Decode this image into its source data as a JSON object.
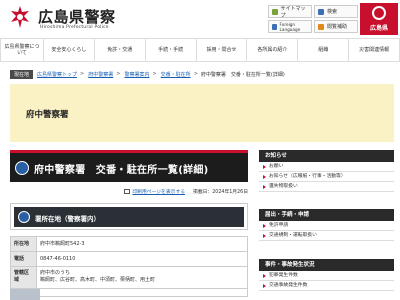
{
  "header": {
    "site_title": "広島県警察",
    "site_subtitle": "Hiroshima Prefectural Police",
    "utility": {
      "sitemap": "サイトマップ",
      "search": "検索",
      "language": "Foreign Language",
      "read_aloud": "閲覧補助"
    },
    "prefecture_badge": "広島県"
  },
  "gnav": [
    "広島県警察について",
    "安全安心くらし",
    "免許・交通",
    "手続・手続",
    "採用・問合せ",
    "各所属の紹介",
    "組織",
    "災害関連情報"
  ],
  "breadcrumb": {
    "here_label": "現在地",
    "items": [
      "広島県警察トップ",
      "府中警察署",
      "警察署案内",
      "交番・駐在所"
    ],
    "current": "府中警察署　交番・駐在所一覧(詳細)"
  },
  "banner": {
    "title": "府中警察署"
  },
  "main": {
    "heading": "府中警察署　交番・駐在所一覧(詳細)",
    "print_link": "印刷用ページを表示する",
    "posted": "掲載日：2024年1月26日",
    "sub_heading": "署所在地（警察署内）",
    "table": [
      {
        "label": "所在地",
        "value": "府中市鵜飼町542-3"
      },
      {
        "label": "電話",
        "value": "0847-46-0110"
      },
      {
        "label": "管轄区域",
        "value": "府中市のうち",
        "value2": "鵜飼町、広谷町、高木町、中須町、栗柄町、用土町"
      },
      {
        "label": "",
        "value": ""
      }
    ]
  },
  "sidebar": {
    "sections": [
      {
        "title": "お知らせ",
        "items": [
          "お願い",
          "お知らせ（広報紙・行事・活動等）",
          "遺失物取扱い"
        ]
      },
      {
        "title": "届出・手続・申請",
        "items": [
          "免許申請",
          "交通規制・運転取扱い"
        ]
      },
      {
        "title": "事件・事故発生状況",
        "items": [
          "犯罪発生件数",
          "交通事故発生件数"
        ]
      }
    ]
  },
  "colors": {
    "accent_red": "#c8102e",
    "banner_yellow": "#faf2c4",
    "heading_dark": "#1c1c1c",
    "link_blue": "#1a5fb4"
  }
}
